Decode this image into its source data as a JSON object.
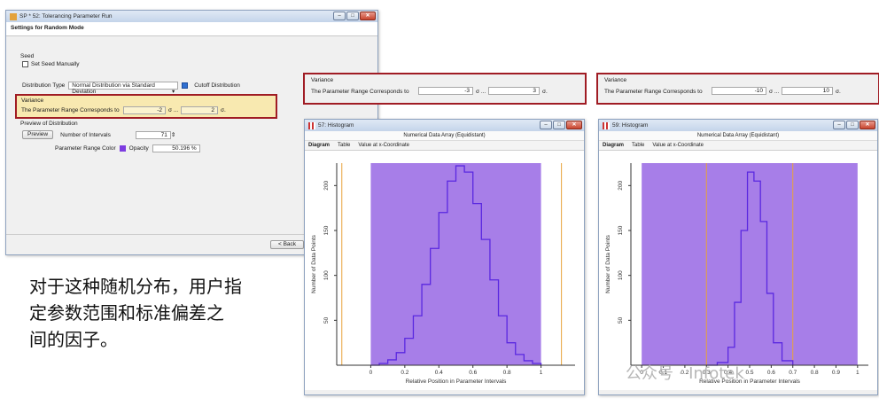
{
  "main_window": {
    "title": "SP * 52: Tolerancing Parameter Run",
    "header": "Settings for Random Mode",
    "seed_group": "Seed",
    "set_seed_label": "Set Seed Manually",
    "distribution_type_label": "Distribution Type",
    "distribution_type_value": "Normal Distribution via Standard Deviation",
    "cutoff_label": "Cutoff Distribution",
    "variance_group": "Variance",
    "variance_label": "The Parameter Range Corresponds to",
    "variance_low": "-2",
    "variance_mid": "σ ...",
    "variance_high": "2",
    "variance_unit": "σ.",
    "preview_group": "Preview of Distribution",
    "preview_button": "Preview",
    "intervals_label": "Number of Intervals",
    "intervals_value": "71",
    "range_color_label": "Parameter Range Color",
    "range_color": "#7d3ce0",
    "opacity_label": "Opacity",
    "opacity_value": "50.196 %",
    "back_button": "< Back"
  },
  "variance_panels": [
    {
      "group": "Variance",
      "label": "The Parameter Range Corresponds to",
      "low": "-3",
      "mid": "σ ...",
      "high": "3",
      "unit": "σ."
    },
    {
      "group": "Variance",
      "label": "The Parameter Range Corresponds to",
      "low": "-10",
      "mid": "σ ...",
      "high": "10",
      "unit": "σ."
    }
  ],
  "histograms": [
    {
      "title": "57: Histogram",
      "header": "Numerical Data Array (Equidistant)",
      "tabs": [
        "Diagram",
        "Table",
        "Value at x-Coordinate"
      ],
      "xlabel": "Relative Position in Parameter Intervals",
      "ylabel": "Number of Data Points"
    },
    {
      "title": "59: Histogram",
      "header": "Numerical Data Array (Equidistant)",
      "tabs": [
        "Diagram",
        "Table",
        "Value at x-Coordinate"
      ],
      "xlabel": "Relative Position in Parameter Intervals",
      "ylabel": "Number of Data Points"
    }
  ],
  "chart_data": [
    {
      "type": "area",
      "title": "",
      "xlabel": "Relative Position in Parameter Intervals",
      "ylabel": "Number of Data Points",
      "xlim": [
        -0.2,
        1.2
      ],
      "ylim": [
        0,
        225
      ],
      "x_ticks": [
        "0",
        "0.2",
        "0.4",
        "0.6",
        "0.8",
        "1"
      ],
      "y_ticks": [
        "50",
        "100",
        "150",
        "200"
      ],
      "highlight_range": [
        0,
        1
      ],
      "marker_lines": [
        -0.17,
        1.12
      ],
      "fill_color": "#a77ee8",
      "line_color": "#5a28e0",
      "x": [
        0.0,
        0.05,
        0.1,
        0.15,
        0.2,
        0.25,
        0.3,
        0.35,
        0.4,
        0.45,
        0.5,
        0.55,
        0.6,
        0.65,
        0.7,
        0.75,
        0.8,
        0.85,
        0.9,
        0.95,
        1.0
      ],
      "values": [
        0,
        2,
        6,
        14,
        30,
        55,
        90,
        130,
        170,
        205,
        222,
        215,
        180,
        140,
        95,
        55,
        25,
        12,
        5,
        2,
        0
      ]
    },
    {
      "type": "area",
      "title": "",
      "xlabel": "Relative Position in Parameter Intervals",
      "ylabel": "Number of Data Points",
      "xlim": [
        -0.05,
        1.05
      ],
      "ylim": [
        0,
        225
      ],
      "x_ticks": [
        "0",
        "0.1",
        "0.2",
        "0.3",
        "0.4",
        "0.5",
        "0.6",
        "0.7",
        "0.8",
        "0.9",
        "1"
      ],
      "y_ticks": [
        "50",
        "100",
        "150",
        "200"
      ],
      "highlight_range": [
        0,
        1
      ],
      "marker_lines": [
        0.3,
        0.7
      ],
      "fill_color": "#a77ee8",
      "line_color": "#5a28e0",
      "x": [
        0.3,
        0.35,
        0.4,
        0.43,
        0.46,
        0.49,
        0.52,
        0.55,
        0.58,
        0.61,
        0.65,
        0.7
      ],
      "values": [
        0,
        3,
        20,
        70,
        150,
        215,
        205,
        160,
        80,
        25,
        5,
        0
      ]
    }
  ],
  "caption": [
    "对于这种随机分布，用户指",
    "定参数范围和标准偏差之",
    "间的因子。"
  ],
  "watermark": "公众号 · Infotek"
}
